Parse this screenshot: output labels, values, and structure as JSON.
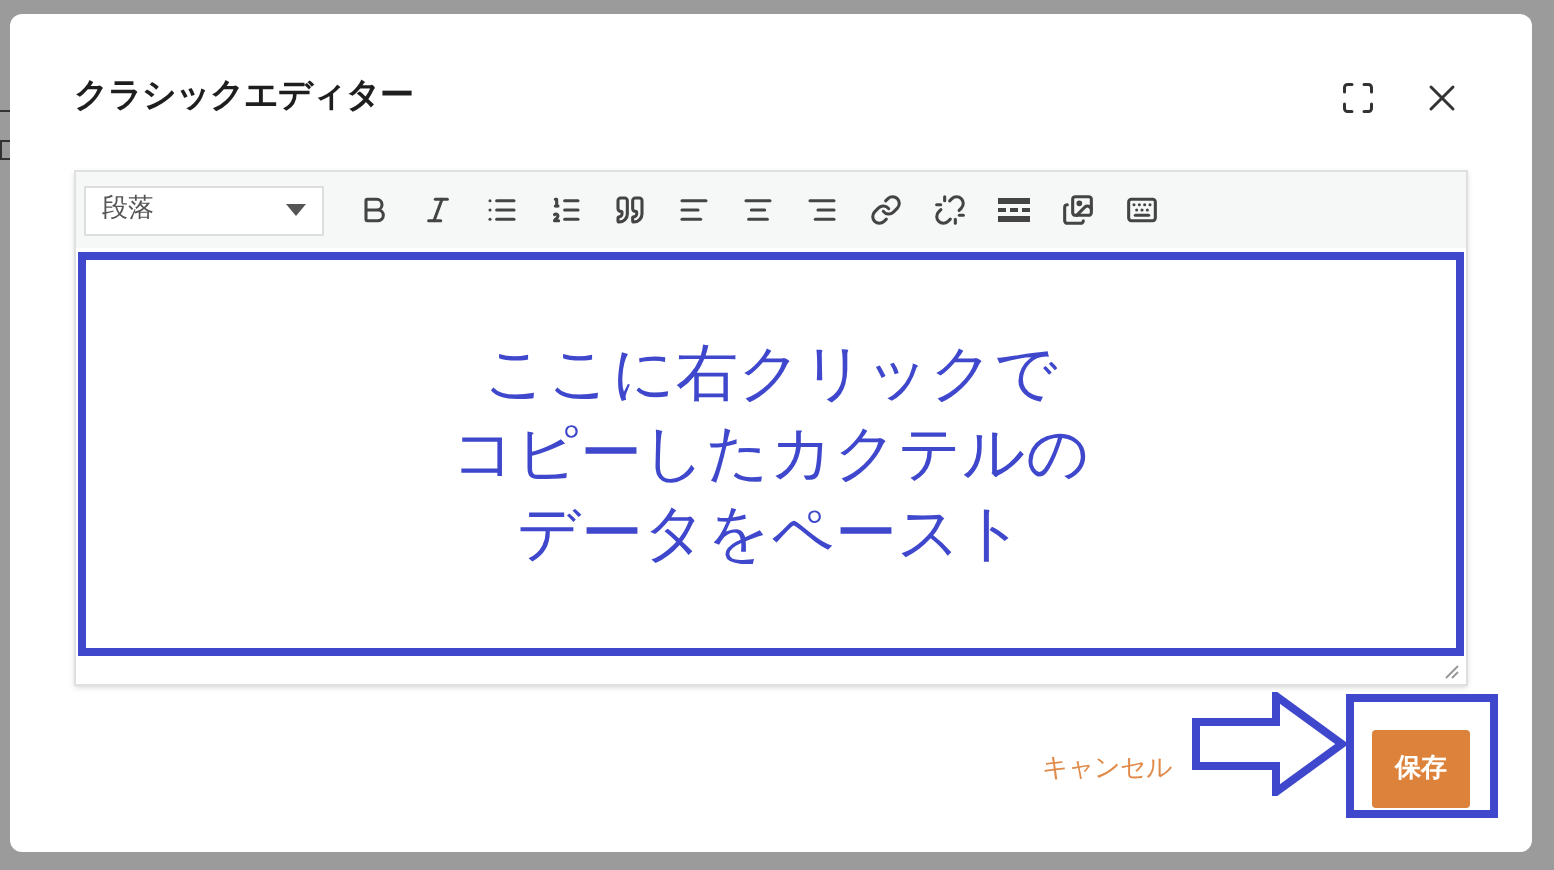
{
  "dialog": {
    "title": "クラシックエディター"
  },
  "toolbar": {
    "format_select": "段落"
  },
  "editor": {
    "content_lines": [
      "ここに右クリックで",
      "コピーしたカクテルの",
      "データをペースト"
    ]
  },
  "footer": {
    "cancel": "キャンセル",
    "save": "保存"
  }
}
